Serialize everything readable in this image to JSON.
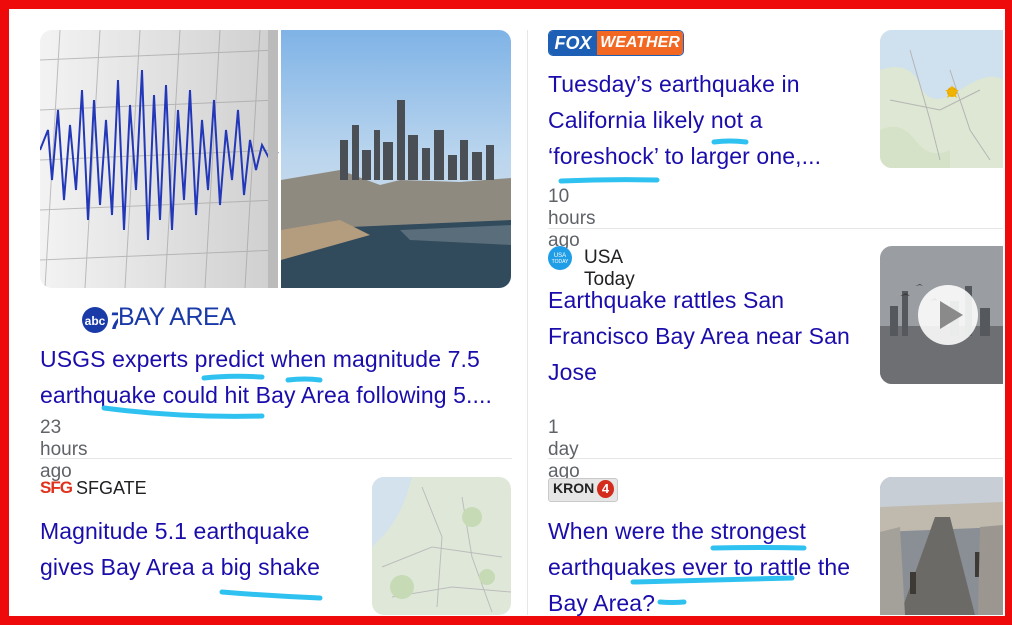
{
  "stories": [
    {
      "source": "BAY AREA",
      "title_lines": [
        "USGS experts predict when magnitude 7.5",
        "earthquake could hit Bay Area following 5...."
      ],
      "time": "23 hours ago"
    },
    {
      "source": "FOX WEATHER",
      "title_lines": [
        "Tuesday’s earthquake in",
        "California likely not a",
        "‘foreshock’ to larger one,..."
      ],
      "time": "10 hours ago"
    },
    {
      "source": "USA Today",
      "title_lines": [
        "Earthquake rattles San",
        "Francisco Bay Area near San",
        "Jose"
      ],
      "time": "1 day ago"
    },
    {
      "source": "SFGATE",
      "source_logo": "SFG",
      "title_lines": [
        "Magnitude 5.1 earthquake",
        "gives Bay Area a big shake"
      ]
    },
    {
      "source": "KRON 4",
      "title_lines": [
        "When were the strongest",
        "earthquakes ever to rattle the",
        "Bay Area?"
      ]
    }
  ],
  "icons": {
    "abc7": "abc7-logo",
    "usa_today": "usa-today-logo",
    "play": "play-icon"
  },
  "colors": {
    "link": "#1a0dab",
    "frame": "#ee0a0a",
    "annotation": "#2fc2f0",
    "fox_blue": "#1d5fb5",
    "fox_orange": "#f26722"
  }
}
